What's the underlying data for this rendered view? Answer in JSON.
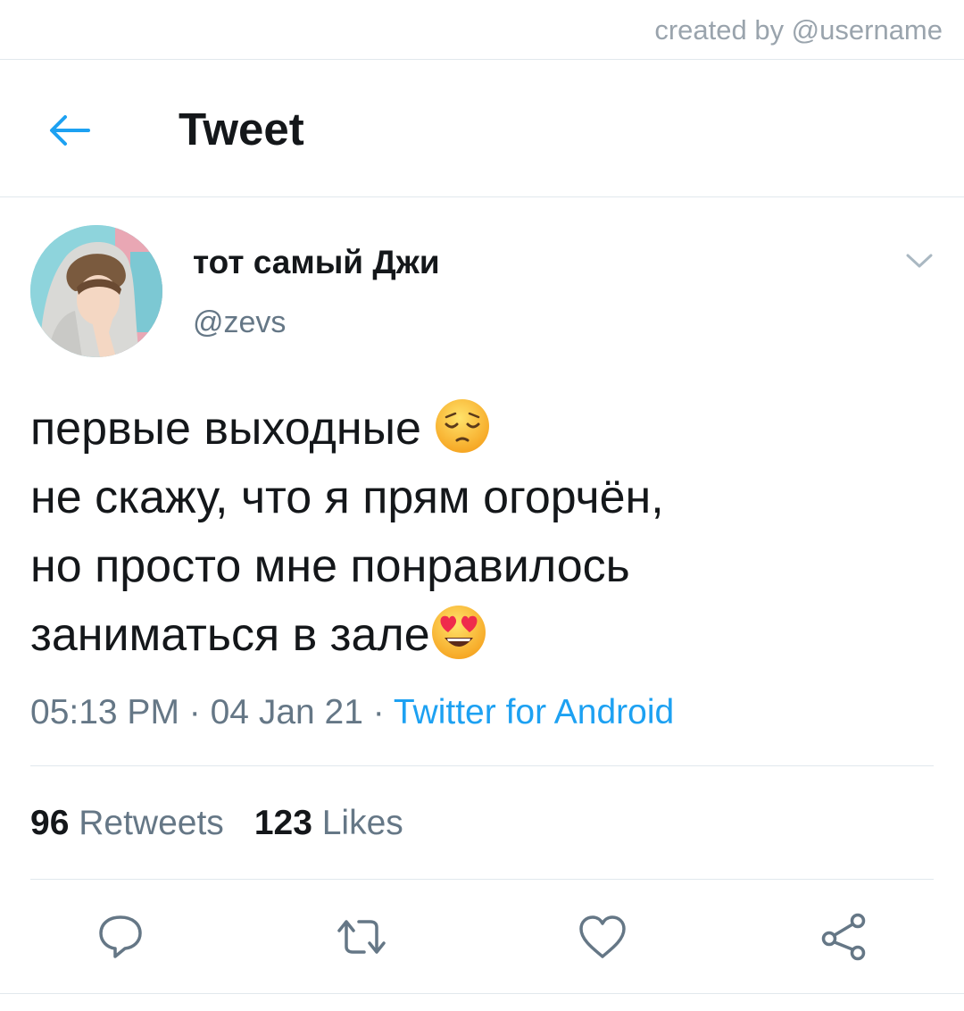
{
  "watermark": "created by @username",
  "header": {
    "title": "Tweet",
    "back_icon": "arrow-left-icon"
  },
  "author": {
    "display_name": "тот самый Джи",
    "handle": "@zevs"
  },
  "tweet": {
    "lines": [
      "первые выходные ",
      "не скажу, что я прям огорчён,",
      "но просто мне понравилось",
      "заниматься в зале"
    ],
    "emojis": [
      "pensive-face",
      "smiling-face-with-heart-eyes"
    ]
  },
  "meta": {
    "time": "05:13 PM",
    "separator": " · ",
    "date": "04 Jan 21",
    "source": "Twitter for Android"
  },
  "stats": {
    "retweets_count": "96",
    "retweets_label": "Retweets",
    "likes_count": "123",
    "likes_label": "Likes"
  },
  "actions": [
    "reply-icon",
    "retweet-icon",
    "like-icon",
    "share-icon"
  ],
  "colors": {
    "accent": "#1da1f2",
    "text_primary": "#14171a",
    "text_secondary": "#657786",
    "divider": "#e1e8ed"
  }
}
